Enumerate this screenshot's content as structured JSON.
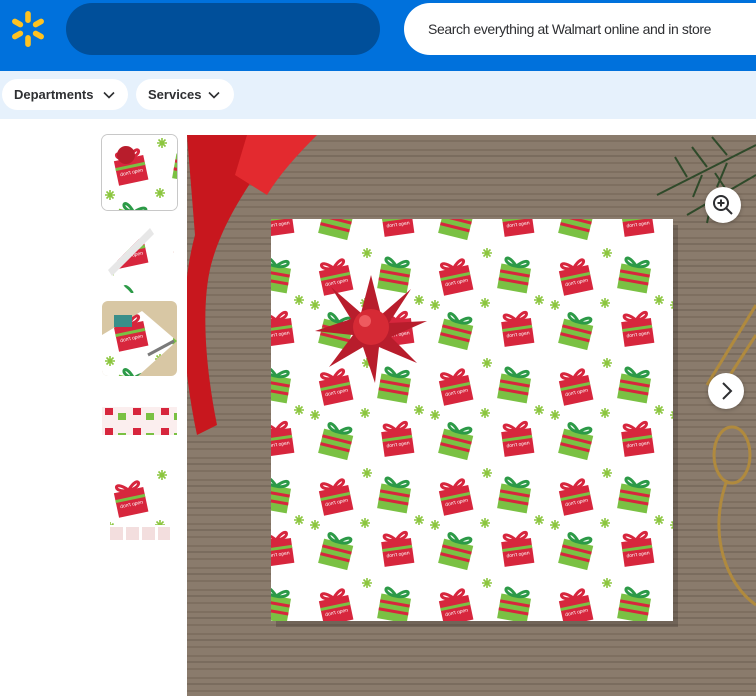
{
  "header": {
    "logo_icon": "walmart-spark-icon",
    "accent_color": "#0071dc",
    "logo_color": "#ffc220",
    "search": {
      "placeholder": "Search everything at Walmart online and in store"
    }
  },
  "subnav": {
    "buttons": [
      {
        "label": "Departments",
        "icon": "chevron-down-icon"
      },
      {
        "label": "Services",
        "icon": "chevron-down-icon"
      }
    ]
  },
  "product": {
    "thumbnails": [
      {
        "name": "gift-wrap-pattern-thumbnail",
        "selected": true
      },
      {
        "name": "gift-wrap-roll-thumbnail",
        "selected": false
      },
      {
        "name": "gift-wrap-in-use-thumbnail",
        "selected": false
      },
      {
        "name": "gift-wrap-strip-thumbnail",
        "selected": false
      },
      {
        "name": "gift-wrap-details-thumbnail",
        "selected": false
      }
    ],
    "main_image": {
      "icon": "product-image",
      "controls": [
        "zoom-in-icon",
        "chevron-right-icon"
      ]
    }
  }
}
